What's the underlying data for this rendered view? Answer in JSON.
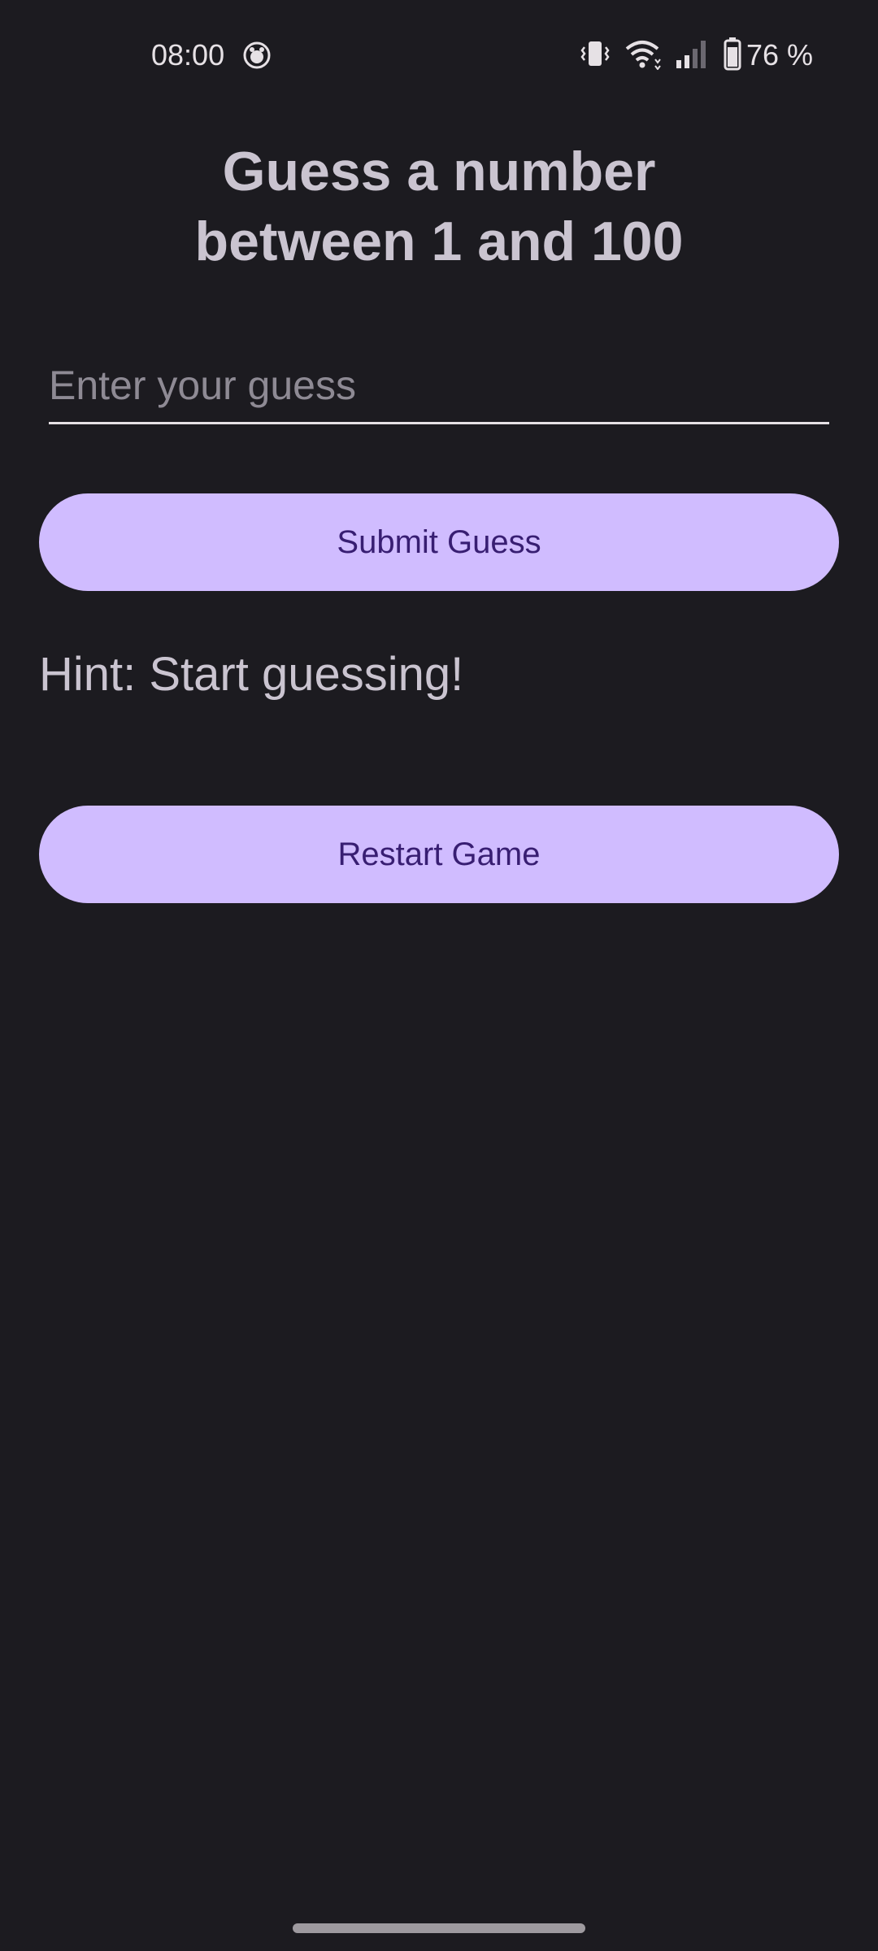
{
  "status_bar": {
    "time": "08:00",
    "battery_text": "76 %",
    "icons": [
      "app-notification-icon",
      "vibrate-icon",
      "wifi-icon",
      "signal-icon",
      "battery-icon"
    ]
  },
  "title": {
    "line1": "Guess a number",
    "line2": "between 1 and 100"
  },
  "guess_input": {
    "value": "",
    "placeholder": "Enter your guess"
  },
  "buttons": {
    "submit_label": "Submit Guess",
    "restart_label": "Restart Game"
  },
  "hint": {
    "text": "Hint: Start guessing!"
  },
  "colors": {
    "background": "#1c1b20",
    "button_bg": "#d0bcff",
    "button_text": "#381e72",
    "text": "#cac4d0"
  }
}
